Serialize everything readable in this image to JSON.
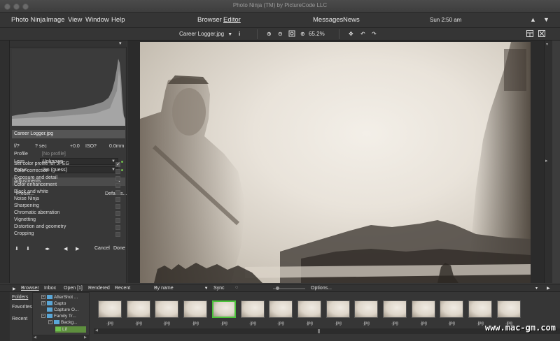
{
  "window": {
    "title": "Photo Ninja (TM) by PictureCode LLC"
  },
  "menubar": {
    "app_name": "Photo Ninja",
    "menus": [
      "Image",
      "View",
      "Window",
      "Help"
    ],
    "modes": [
      "Browser",
      "Editor"
    ],
    "active_mode": "Editor",
    "right_items": [
      "Messages",
      "News"
    ],
    "clock": "Sun 2:50 am"
  },
  "toolbar": {
    "filename": "Career Logger.jpg",
    "info_icon": "i",
    "zoom": "65.2%"
  },
  "left": {
    "file_label": "Career Logger.jpg",
    "exif": {
      "aperture": "f/?",
      "shutter": "? sec",
      "ev": "+0.0",
      "iso": "ISO?",
      "focal": "0.0mm"
    },
    "profile_label": "Profile",
    "profile_value": "[No profile]",
    "lens_label": "Lens",
    "lens_value": "Unknown",
    "focus_label": "Focus",
    "focus_value": "2m (guess)",
    "adjustments_label": "Adjustments",
    "preset_label": "Preset...",
    "defaults_label": "Defaults...",
    "adjustments": [
      {
        "label": "Set color profile for JPEG",
        "checked": true
      },
      {
        "label": "Color correction",
        "checked": false
      },
      {
        "label": "Exposure and detail",
        "checked": false
      },
      {
        "label": "Color enhancement",
        "checked": false
      },
      {
        "label": "Black and white",
        "checked": false
      },
      {
        "label": "Noise Ninja",
        "checked": false
      },
      {
        "label": "Sharpening",
        "checked": false
      },
      {
        "label": "Chromatic aberration",
        "checked": false
      },
      {
        "label": "Vignetting",
        "checked": false
      },
      {
        "label": "Distortion and geometry",
        "checked": false
      },
      {
        "label": "Cropping",
        "checked": false
      }
    ],
    "cancel_label": "Cancel",
    "done_label": "Done"
  },
  "browser": {
    "tabs": [
      "Browser",
      "Inbox",
      "Open [1]",
      "Rendered",
      "Recent"
    ],
    "sort_label": "By name",
    "sync_label": "Sync",
    "options_label": "Options...",
    "nav": [
      "Folders",
      "Favorites",
      "Recent"
    ],
    "folders": [
      {
        "label": "AfterShot ..."
      },
      {
        "label": "Capto"
      },
      {
        "label": "Capture O..."
      },
      {
        "label": "Family Tr..."
      },
      {
        "label": "Backg..."
      },
      {
        "label": "Lif"
      }
    ],
    "thumbnails": [
      ".jpg",
      ".jpg",
      ".jpg",
      ".jpg",
      ".jpg",
      ".jpg",
      ".jpg",
      ".jpg",
      ".jpg",
      ".jpg",
      ".jpg",
      ".jpg",
      ".jpg",
      ".jpg",
      ".jpg"
    ],
    "selected_thumbnail": 4
  },
  "watermark": "www.mac-gm.com",
  "colors": {
    "accent_green": "#4cc23a",
    "panel": "#383838",
    "folder_blue": "#5aa6d6"
  }
}
